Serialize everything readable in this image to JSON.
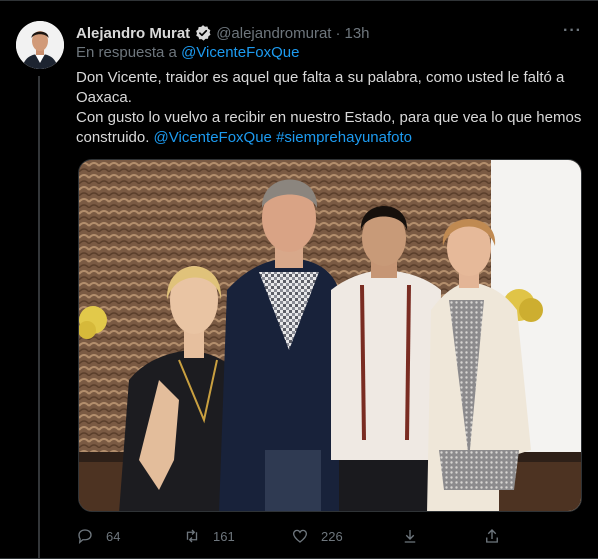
{
  "tweet": {
    "author_name": "Alejandro Murat",
    "author_handle": "@alejandromurat",
    "separator": "·",
    "time": "13h",
    "reply_prefix": "En respuesta a ",
    "reply_mention": "@VicenteFoxQue",
    "text_line1": "Don Vicente, traidor es aquel que falta a su palabra, como usted le faltó a Oaxaca.",
    "text_line2": "Con gusto lo vuelvo a recibir en nuestro Estado, para que vea lo que hemos construido. ",
    "text_mention": "@VicenteFoxQue",
    "text_space": " ",
    "text_hashtag": "#siemprehayunafoto"
  },
  "actions": {
    "reply_count": "64",
    "retweet_count": "161",
    "like_count": "226"
  },
  "icons": {
    "verified": "verified-badge-icon",
    "more": "more-options-icon",
    "reply": "reply-icon",
    "retweet": "retweet-icon",
    "like": "like-icon",
    "bookmark": "bookmark-icon",
    "share": "share-icon"
  },
  "colors": {
    "background": "#000000",
    "accent": "#1d9bf0",
    "muted": "#6e767d",
    "text": "#d9d9d9"
  }
}
